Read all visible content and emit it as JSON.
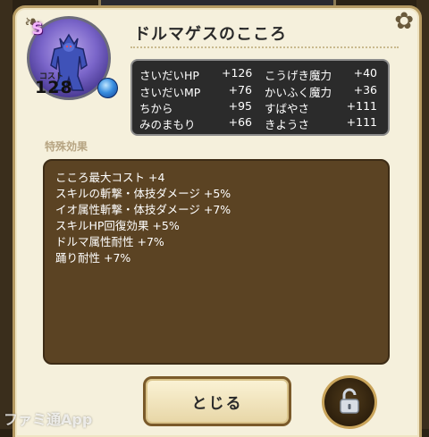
{
  "card": {
    "rank": "S",
    "cost_label": "コスト",
    "cost_value": "128",
    "title": "ドルマゲスのこころ"
  },
  "stats": [
    {
      "label1": "さいだいHP",
      "value1": "+126",
      "label2": "こうげき魔力",
      "value2": "+40"
    },
    {
      "label1": "さいだいMP",
      "value1": "+76",
      "label2": "かいふく魔力",
      "value2": "+36"
    },
    {
      "label1": "ちから",
      "value1": "+95",
      "label2": "すばやさ",
      "value2": "+111"
    },
    {
      "label1": "みのまもり",
      "value1": "+66",
      "label2": "きようさ",
      "value2": "+111"
    }
  ],
  "special": {
    "heading": "特殊効果",
    "effects": [
      "こころ最大コスト +4",
      "スキルの斬撃・体技ダメージ +5%",
      "イオ属性斬撃・体技ダメージ +7%",
      "スキルHP回復効果 +5%",
      "ドルマ属性耐性 +7%",
      "踊り耐性 +7%"
    ]
  },
  "buttons": {
    "close_label": "とじる"
  },
  "icons": {
    "orb": "blue-orb-icon",
    "lock": "unlocked-padlock-icon"
  },
  "watermark": "ファミ通App"
}
